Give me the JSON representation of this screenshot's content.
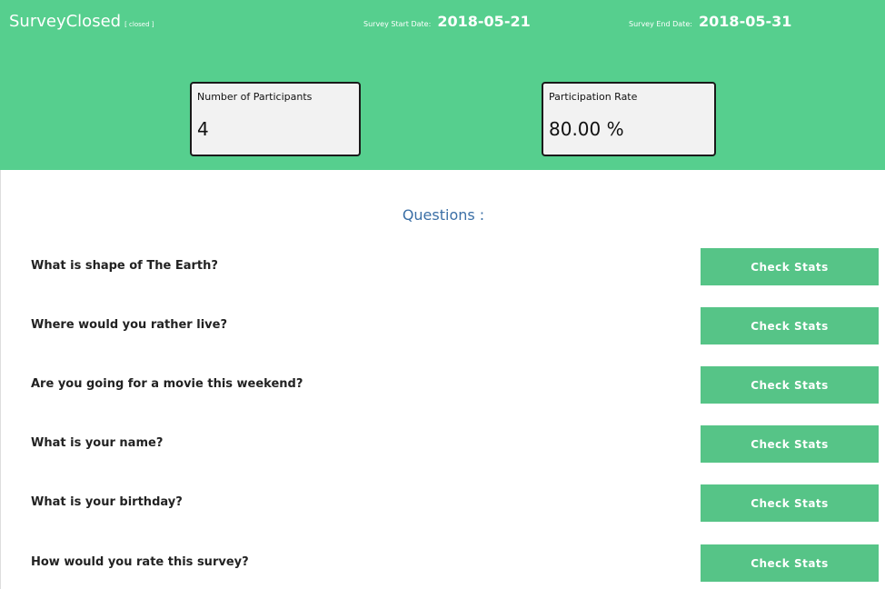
{
  "survey": {
    "name": "SurveyClosed",
    "status": "[ closed ]",
    "start_label": "Survey Start Date:",
    "start_value": "2018-05-21",
    "end_label": "Survey End Date:",
    "end_value": "2018-05-31"
  },
  "stats": {
    "participants_label": "Number of Participants",
    "participants_value": "4",
    "rate_label": "Participation Rate",
    "rate_value": "80.00 %"
  },
  "colors": {
    "header_bg": "#56cf8e",
    "button_bg": "#56c487",
    "heading_text": "#3b6fa6"
  },
  "questions": {
    "heading": "Questions :",
    "button_label": "Check Stats",
    "items": [
      {
        "text": "What is shape of The Earth?"
      },
      {
        "text": "Where would you rather live?"
      },
      {
        "text": "Are you going for a movie this weekend?"
      },
      {
        "text": "What is your name?"
      },
      {
        "text": "What is your birthday?"
      },
      {
        "text": "How would you rate this survey?"
      }
    ]
  }
}
